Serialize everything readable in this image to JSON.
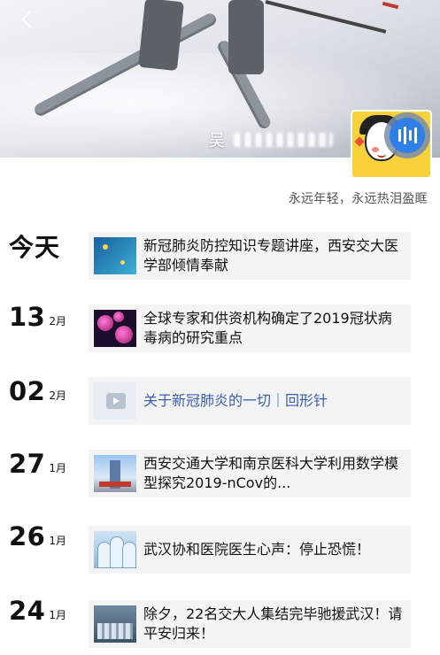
{
  "profile": {
    "name_visible": "吴",
    "signature": "永远年轻，永远热泪盈眶"
  },
  "posts": [
    {
      "day": "今天",
      "month": "",
      "title": "新冠肺炎防控知识专题讲座，西安交大医学部倾情奉献",
      "thumb_icon": "lecture-thumbnail"
    },
    {
      "day": "13",
      "month": "2月",
      "title": "全球专家和供资机构确定了2019冠状病毒病的研究重点",
      "thumb_icon": "virus-thumbnail"
    },
    {
      "day": "02",
      "month": "2月",
      "title": "关于新冠肺炎的一切｜回形针",
      "thumb_icon": "video-thumbnail"
    },
    {
      "day": "27",
      "month": "1月",
      "title": "西安交通大学和南京医科大学利用数学模型探究2019-nCov的...",
      "thumb_icon": "campus-thumbnail"
    },
    {
      "day": "26",
      "month": "1月",
      "title": "武汉协和医院医生心声：停止恐慌！",
      "thumb_icon": "doctors-thumbnail"
    },
    {
      "day": "24",
      "month": "1月",
      "title": "除夕，22名交大人集结完毕驰援武汉！请平安归来！",
      "thumb_icon": "team-thumbnail"
    }
  ]
}
